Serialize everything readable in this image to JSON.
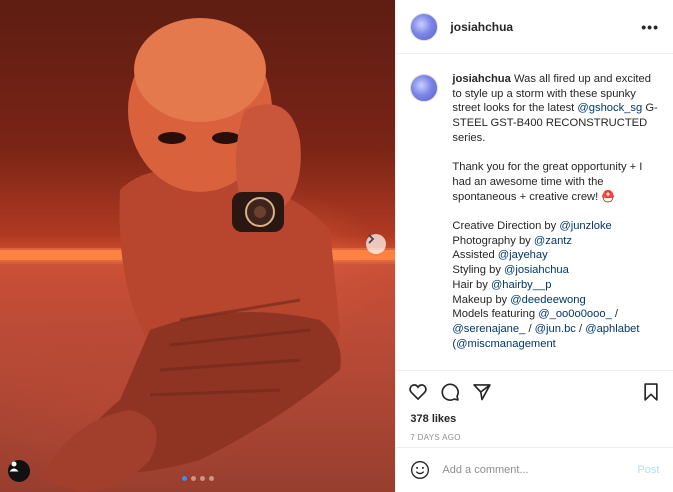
{
  "post": {
    "username": "josiahchua",
    "more_label": "•••",
    "carousel_dots": 4,
    "active_dot": 0
  },
  "caption": {
    "username": "josiahchua",
    "intro_a": "Was all fired up and excited to style up a storm with these spunky street looks for the latest ",
    "intro_link": "@gshock_sg",
    "intro_b": " G-STEEL GST-B400 RECONSTRUCTED series.",
    "thanks": "Thank you for the great opportunity + I had an awesome time with the spontaneous + creative crew! ⛑️",
    "credits": [
      {
        "label": "Creative Direction by ",
        "handle": "@junzloke"
      },
      {
        "label": "Photography by ",
        "handle": "@zantz"
      },
      {
        "label": "Assisted ",
        "handle": "@jayehay"
      },
      {
        "label": "Styling by ",
        "handle": "@josiahchua"
      },
      {
        "label": "Hair by ",
        "handle": "@hairby__p"
      },
      {
        "label": "Makeup by ",
        "handle": "@deedeewong"
      }
    ],
    "models_label": "Models featuring ",
    "models_handle_1": "@_oo0o0ooo_",
    "models_sep_1": " /",
    "models_handle_2": "@serenajane_",
    "models_sep_2": " / ",
    "models_handle_3": "@jun.bc",
    "models_sep_3": " / ",
    "models_handle_4": "@aphlabet",
    "models_open_paren": "(",
    "models_handle_5": "@miscmanagement"
  },
  "stats": {
    "likes": "378 likes",
    "date": "7 DAYS AGO"
  },
  "comment_box": {
    "placeholder": "Add a comment...",
    "post_label": "Post"
  },
  "colors": {
    "link": "#00376b",
    "post_disabled": "#b2dffc",
    "active_dot": "#3b8ff0"
  }
}
